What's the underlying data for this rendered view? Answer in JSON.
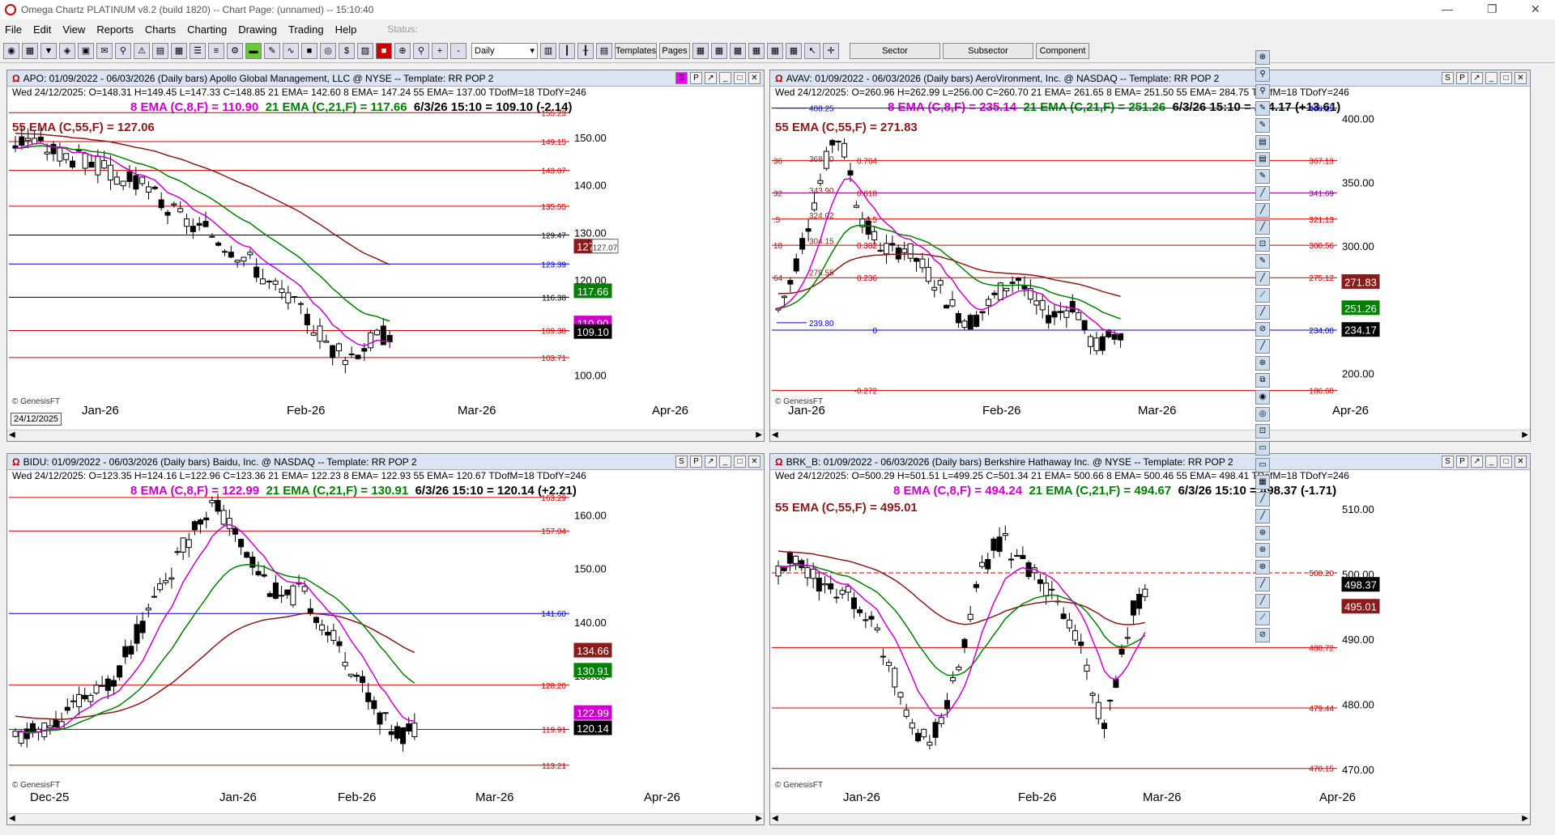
{
  "window": {
    "title": "Omega Chartz PLATINUM v8.2 (build 1820)  --  Chart Page: (unnamed)  --  15:10:40"
  },
  "menu": {
    "items": [
      "File",
      "Edit",
      "View",
      "Reports",
      "Charts",
      "Charting",
      "Drawing",
      "Trading",
      "Help"
    ],
    "status_label": "Status:"
  },
  "toolbar": {
    "period_value": "Daily",
    "templates_label": "Templates",
    "pages_label": "Pages",
    "sector_label": "Sector",
    "subsector_label": "Subsector",
    "component_label": "Component"
  },
  "colors": {
    "ema8": "#cc00cc",
    "ema21": "#008000",
    "ema55": "#8b1a1a",
    "fib_red": "#cc0000",
    "fib_blue": "#0000cc",
    "header_bg": "#dae4f2"
  },
  "panels": [
    {
      "id": "apo",
      "header": "APO: 01/09/2022 - 06/03/2026  (Daily bars)  Apollo Global Management, LLC @ NYSE  --  Template: RR POP 2",
      "info": "Wed 24/12/2025:  O=148.31  H=149.45  L=147.33  C=148.85  21 EMA= 142.60  8 EMA= 147.24  55 EMA= 137.00  TDofM=18  TDofY=246",
      "ind_ema8": "8 EMA (C,8,F) = 110.90",
      "ind_ema21": "21 EMA (C,21,F) = 117.66",
      "ind_last": "6/3/26 15:10 = 109.10 (-2.14)",
      "ind_ema55": "55 EMA (C,55,F) = 127.06",
      "y_ticks": [
        "150.00",
        "140.00",
        "130.00",
        "120.00",
        "110.00",
        "100.00"
      ],
      "levels": [
        "155.23",
        "149.15",
        "143.07",
        "135.55",
        "129.47",
        "123.39",
        "116.38",
        "109.38",
        "103.71"
      ],
      "price_tags": [
        "127.06",
        "117.66",
        "110.90",
        "109.10",
        "127.07"
      ],
      "x_labels": [
        "Jan-26",
        "Feb-26",
        "Mar-26",
        "Apr-26"
      ],
      "date_box": "24/12/2025"
    },
    {
      "id": "avav",
      "header": "AVAV: 01/09/2022 - 06/03/2026  (Daily bars)  AeroVironment, Inc. @ NASDAQ  --  Template: RR POP 2",
      "info": "Wed 24/12/2025:  O=260.96  H=262.99  L=256.00  C=260.70  21 EMA= 261.65  8 EMA= 251.50  55 EMA= 284.75  TDofM=18  TDofY=246",
      "ind_ema8": "8 EMA (C,8,F) = 235.14",
      "ind_ema21": "21 EMA (C,21,F) = 251.26",
      "ind_last": "6/3/26 15:10 = 234.17 (+13.61)",
      "ind_ema55": "55 EMA (C,55,F) = 271.83",
      "y_ticks": [
        "400.00",
        "350.00",
        "300.00",
        "250.00",
        "200.00"
      ],
      "levels": [
        "408.25",
        "367.13",
        "341.69",
        "321.13",
        "300.56",
        "275.12",
        "234.00",
        "186.60"
      ],
      "fib_ratios": [
        "0.236",
        "0.382",
        "0.5",
        "0.618",
        "0.764",
        "0",
        "-0.272"
      ],
      "left_fib": [
        "408.25",
        "368.50",
        "343.90",
        "324.02",
        "304.15",
        "279.55",
        "239.80"
      ],
      "left_cut": [
        "36",
        "32",
        ".5",
        "18",
        "64"
      ],
      "price_tags": [
        "271.83",
        "251.26",
        "234.17"
      ],
      "x_labels": [
        "Jan-26",
        "Feb-26",
        "Mar-26",
        "Apr-26"
      ]
    },
    {
      "id": "bidu",
      "header": "BIDU: 01/09/2022 - 06/03/2026  (Daily bars)  Baidu, Inc. @ NASDAQ  --  Template: RR POP 2",
      "info": "Wed 24/12/2025:  O=123.35  H=124.16  L=122.96  C=123.36  21 EMA= 122.23  8 EMA= 122.93  55 EMA= 120.67  TDofM=18  TDofY=246",
      "ind_ema8": "8 EMA (C,8,F) = 122.99",
      "ind_ema21": "21 EMA (C,21,F) = 130.91",
      "ind_last": "6/3/26 15:10 = 120.14 (+2.21)",
      "y_ticks": [
        "160.00",
        "150.00",
        "140.00",
        "130.00",
        "120.00"
      ],
      "levels": [
        "163.29",
        "157.04",
        "141.60",
        "128.20",
        "119.91",
        "113.21"
      ],
      "price_tags": [
        "134.66",
        "130.91",
        "122.99",
        "120.14"
      ],
      "x_labels": [
        "Dec-25",
        "Jan-26",
        "Feb-26",
        "Mar-26",
        "Apr-26"
      ]
    },
    {
      "id": "brkb",
      "header": "BRK_B: 01/09/2022 - 06/03/2026  (Daily bars)  Berkshire Hathaway Inc. @ NYSE  --  Template: RR POP 2",
      "info": "Wed 24/12/2025:  O=500.29  H=501.51  L=499.25  C=501.34  21 EMA= 500.66  8 EMA= 500.46  55 EMA= 498.41  TDofM=18  TDofY=246",
      "ind_ema8": "8 EMA (C,8,F) = 494.24",
      "ind_ema21": "21 EMA (C,21,F) = 494.67",
      "ind_last": "6/3/26 15:10 = 498.37 (-1.71)",
      "ind_ema55": "55 EMA (C,55,F) = 495.01",
      "y_ticks": [
        "510.00",
        "500.00",
        "490.00",
        "480.00",
        "470.00"
      ],
      "levels": [
        "500.20",
        "488.72",
        "479.44",
        "470.15"
      ],
      "price_tags": [
        "498.37",
        "495.01"
      ],
      "x_labels": [
        "Jan-26",
        "Feb-26",
        "Mar-26",
        "Apr-26"
      ]
    }
  ],
  "footer": {
    "watermark": "© GenesisFT",
    "panel_buttons": [
      "S",
      "P",
      "↗",
      "_",
      "□",
      "✕"
    ]
  }
}
